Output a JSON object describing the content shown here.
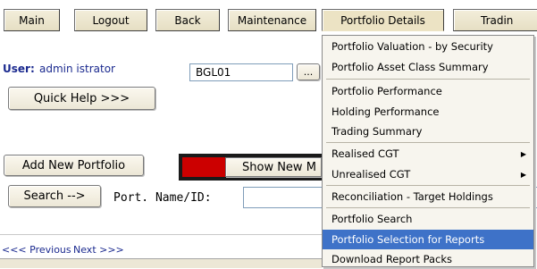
{
  "nav": {
    "items": [
      {
        "label": "Main"
      },
      {
        "label": "Logout"
      },
      {
        "label": "Back"
      },
      {
        "label": "Maintenance"
      },
      {
        "label": "Portfolio Details"
      },
      {
        "label": "Tradin"
      }
    ]
  },
  "user": {
    "label": "User:",
    "name": "admin istrator"
  },
  "portfolio_code": {
    "value": "BGL01",
    "ellipsis": "..."
  },
  "buttons": {
    "quick_help": "Quick Help >>>",
    "add_new_portfolio": "Add New Portfolio",
    "show_new": "Show New M",
    "search": "Search -->"
  },
  "search": {
    "label": "Port. Name/ID:",
    "value": ""
  },
  "pager": {
    "previous": "<<< Previous",
    "next": "Next >>>"
  },
  "menu": {
    "items": [
      {
        "label": "Portfolio Valuation - by Security",
        "submenu": false
      },
      {
        "label": "Portfolio Asset Class Summary",
        "submenu": false
      },
      {
        "label": "Portfolio Performance",
        "submenu": false
      },
      {
        "label": "Holding Performance",
        "submenu": false
      },
      {
        "label": "Trading Summary",
        "submenu": false
      },
      {
        "label": "Realised CGT",
        "submenu": true
      },
      {
        "label": "Unrealised CGT",
        "submenu": true
      },
      {
        "label": "Reconciliation - Target Holdings",
        "submenu": false
      },
      {
        "label": "Portfolio Search",
        "submenu": false
      },
      {
        "label": "Portfolio Selection for Reports",
        "submenu": false,
        "selected": true
      },
      {
        "label": "Download Report Packs",
        "submenu": false
      }
    ],
    "submenu_arrow": "▶"
  },
  "colors": {
    "menu_highlight": "#3e72c8",
    "label_blue": "#1b2a8f",
    "red_block": "#cc0000"
  }
}
